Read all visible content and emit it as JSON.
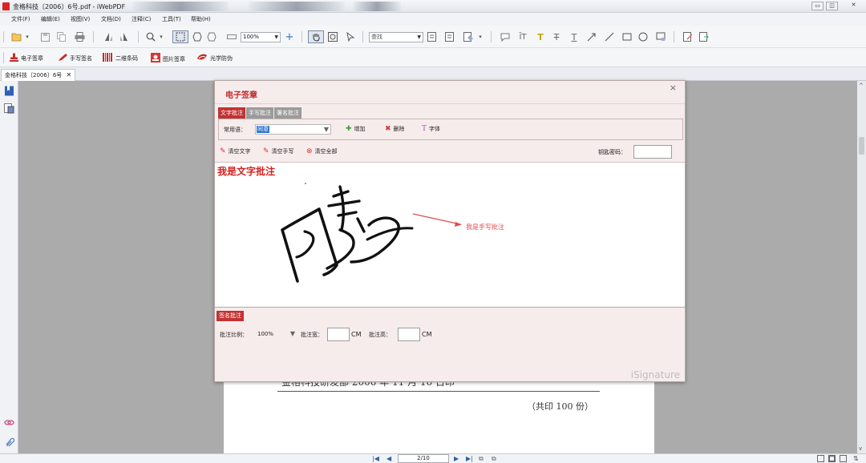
{
  "window": {
    "title": "金格科技〔2006〕6号.pdf - iWebPDF",
    "controls": [
      "▭",
      "◫",
      "✕"
    ]
  },
  "menu": [
    "文件(F)",
    "编辑(E)",
    "视图(V)",
    "文档(D)",
    "注释(C)",
    "工具(T)",
    "帮助(H)"
  ],
  "toolbar": {
    "zoom": "100%",
    "search_placeholder": "查找"
  },
  "sigbar": [
    {
      "label": "电子签章",
      "icon": "stamp-icon",
      "color": "#d12a2a"
    },
    {
      "label": "手写签名",
      "icon": "pen-icon",
      "color": "#d12a2a"
    },
    {
      "label": "二维条码",
      "icon": "barcode-icon",
      "color": "#d12a2a"
    },
    {
      "label": "图片签章",
      "icon": "image-stamp-icon",
      "color": "#d12a2a"
    },
    {
      "label": "光学防伪",
      "icon": "optical-icon",
      "color": "#d12a2a"
    }
  ],
  "document_tab": {
    "label": "金格科技〔2006〕6号",
    "close": "✕"
  },
  "document": {
    "cut_text": "金格科技研发部                          2006 年 11 月 16 日印",
    "copies": "（共印 100 份）"
  },
  "statusbar": {
    "page": "2/10"
  },
  "dialog": {
    "title": "电子签章",
    "close": "×",
    "tabs": [
      "文字批注",
      "手写批注",
      "署名批注"
    ],
    "phrase_label": "常用语：",
    "phrase_value": "同意",
    "add_label": "增加",
    "delete_label": "删除",
    "font_label": "字体",
    "clear_text": "清空文字",
    "clear_hand": "清空手写",
    "clear_all": "清空全部",
    "password_label": "钥匙密码：",
    "text_annotation": "我是文字批注",
    "hand_annotation": "我是手写批注",
    "sign_tab": "签名批注",
    "ratio_label": "批注比例：",
    "ratio_value": "100%",
    "width_label": "批注宽：",
    "height_label": "批注高：",
    "unit": "CM",
    "watermark": "iSignature"
  },
  "colors": {
    "accent": "#c33232",
    "annotation_red": "#d61e1e",
    "dialog_bg": "#f7ecec"
  }
}
